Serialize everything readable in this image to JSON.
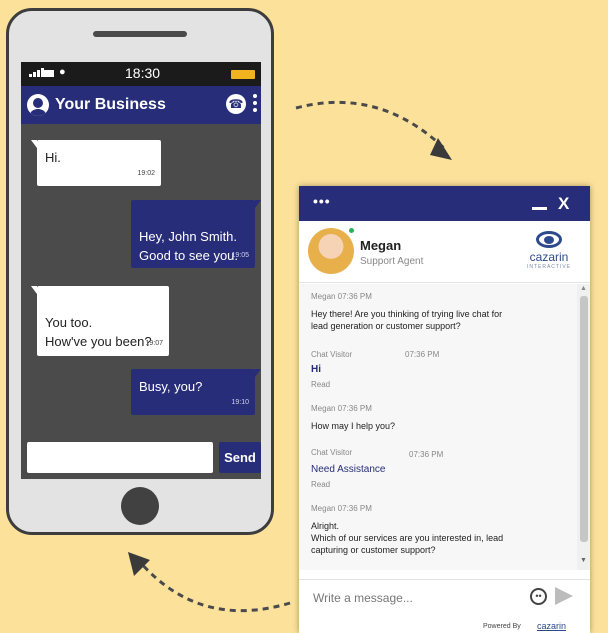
{
  "phone": {
    "status": {
      "time": "18:30"
    },
    "header": {
      "title": "Your Business"
    },
    "messages": [
      {
        "dir": "in",
        "text": "Hi.",
        "time": "19:02"
      },
      {
        "dir": "out",
        "text": "Hey, John Smith.\nGood to see you.",
        "time": "19:05"
      },
      {
        "dir": "in",
        "text": "You too.\nHow've you been?",
        "time": "19:07"
      },
      {
        "dir": "out",
        "text": "Busy, you?",
        "time": "19:10"
      }
    ],
    "composer": {
      "send_label": "Send"
    }
  },
  "widget": {
    "header": {
      "menu": "•••",
      "close": "X"
    },
    "agent": {
      "name": "Megan",
      "role": "Support Agent"
    },
    "brand": {
      "name": "cazarin",
      "sub": "INTERACTIVE"
    },
    "messages": [
      {
        "meta": "Megan 07:36 PM",
        "text": "Hey there! Are you thinking of trying live chat for\nlead generation or customer support?"
      },
      {
        "sender": "Chat Visitor",
        "time": "07:36 PM",
        "text": "Hi",
        "status": "Read"
      },
      {
        "meta": "Megan 07:36 PM",
        "text": "How may I help you?"
      },
      {
        "sender": "Chat Visitor",
        "time": "07:36 PM",
        "text": "Need Assistance",
        "status": "Read"
      },
      {
        "meta": "Megan 07:36 PM",
        "text": "Alright.\nWhich of our services are you interested in, lead\ncapturing or customer support?"
      }
    ],
    "input": {
      "placeholder": "Write a message..."
    },
    "footer": {
      "powered": "Powered By",
      "logo": "cazarin"
    }
  }
}
